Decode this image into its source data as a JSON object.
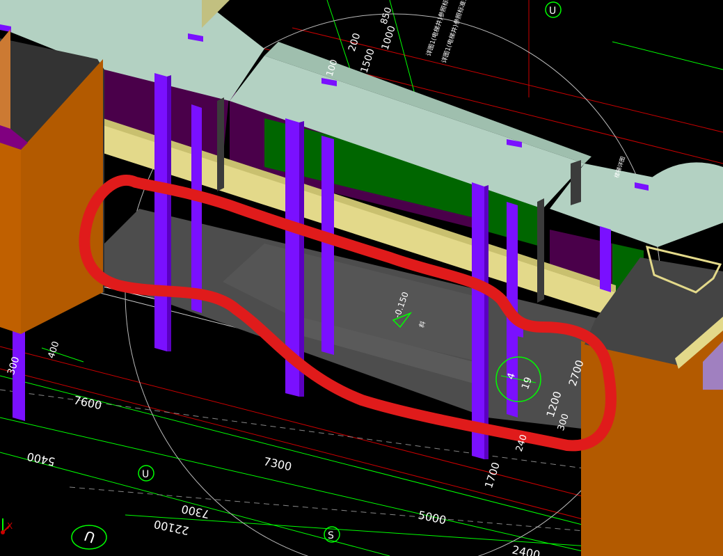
{
  "viewport": {
    "name": "bim-3d-viewport",
    "background": "#000000"
  },
  "colors": {
    "column": "#7a10ff",
    "slab_top": "#b3d1c2",
    "beam_yellow": "#e3d98a",
    "wall_orange": "#b35a00",
    "wall_dark": "#3a3a3a",
    "wall_green": "#006600",
    "wall_purple": "#4a004a",
    "floor_gray": "#4d4d4d",
    "annotation_red": "#e01b1b",
    "grid_green": "#00ff00",
    "grid_red": "#cc0000",
    "grid_gray": "#aaaaaa"
  },
  "dimensions": {
    "d7600": "7600",
    "d7300": "7300",
    "d5400": "5400",
    "d5000": "5000",
    "d7300b": "7300",
    "d22100": "22100",
    "d2400": "2400",
    "d1700": "1700",
    "d2700": "2700",
    "d1200": "1200",
    "d300": "300",
    "d1500": "1500",
    "d1000": "1000",
    "d200": "200",
    "d400": "400",
    "d100": "100",
    "d850": "850",
    "d300c": "300",
    "d2400c": "240"
  },
  "elevation": {
    "value": "-0.150",
    "label": "斜"
  },
  "axis_bubbles": {
    "u_top": "U",
    "u_mid": "U",
    "s_bottom": "S",
    "u_bottom_left": "U"
  },
  "detail_bubble": {
    "top": "4",
    "bottom": "19"
  },
  "notes": {
    "top_right_1": "详图1(电梯井)参照标准详图",
    "top_right_2": "详图1(电梯井)参照标准详图",
    "right_mid": "楼梯详图"
  },
  "ucs": {
    "x_label": "X"
  }
}
